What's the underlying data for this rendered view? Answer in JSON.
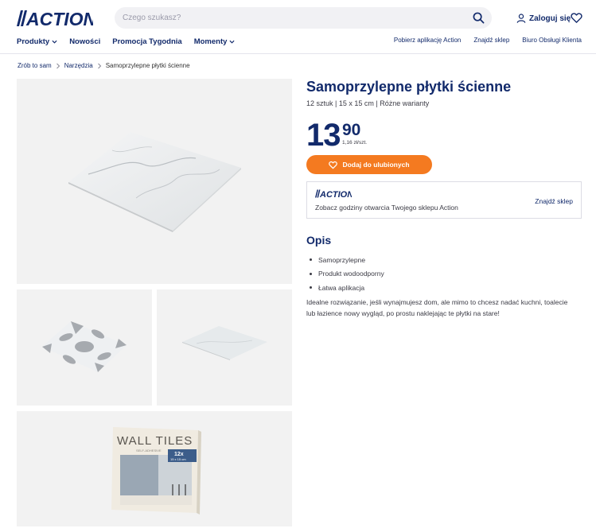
{
  "brand": {
    "logo_text": "ACTION",
    "color": "#122a6b",
    "accent": "#f47a20"
  },
  "search": {
    "placeholder": "Czego szukasz?",
    "value": "",
    "icon": "search-icon"
  },
  "account": {
    "login_label": "Zaloguj się",
    "login_icon": "user-icon",
    "favorites_icon": "heart-icon"
  },
  "nav": {
    "items": [
      {
        "label": "Produkty",
        "has_dropdown": true
      },
      {
        "label": "Nowości",
        "has_dropdown": false
      },
      {
        "label": "Promocja Tygodnia",
        "has_dropdown": false
      },
      {
        "label": "Momenty",
        "has_dropdown": true
      }
    ],
    "right_links": [
      "Pobierz aplikację Action",
      "Znajdź sklep",
      "Biuro Obsługi Klienta"
    ]
  },
  "breadcrumb": {
    "items": [
      "Zrób to sam",
      "Narzędzia"
    ],
    "current": "Samoprzylepne płytki ścienne"
  },
  "product": {
    "title": "Samoprzylepne płytki ścienne",
    "subtitle": "12 sztuk | 15 x 15 cm | Różne warianty",
    "price_main": "13",
    "price_decimal": "90",
    "unit_price": "1,16 zł/szt.",
    "favorite_button": "Dodaj do ulubionych"
  },
  "store": {
    "logo_text": "ACTION",
    "text": "Zobacz godziny otwarcia Twojego sklepu Action",
    "link": "Znajdź sklep"
  },
  "description": {
    "title": "Opis",
    "bullets": [
      "Samoprzylepne",
      "Produkt wodoodporny",
      "Łatwa aplikacja"
    ],
    "text": "Idealne rozwiązanie, jeśli wynajmujesz dom, ale mimo to chcesz nadać kuchni, toalecie lub łazience nowy wygląd, po prostu naklejając te płytki na stare!"
  },
  "gallery": {
    "packaging_title": "WALL TILES",
    "packaging_subtitle": "SELF-ADHESIVE",
    "packaging_count": "12x",
    "packaging_size": "15 x 15 cm"
  }
}
